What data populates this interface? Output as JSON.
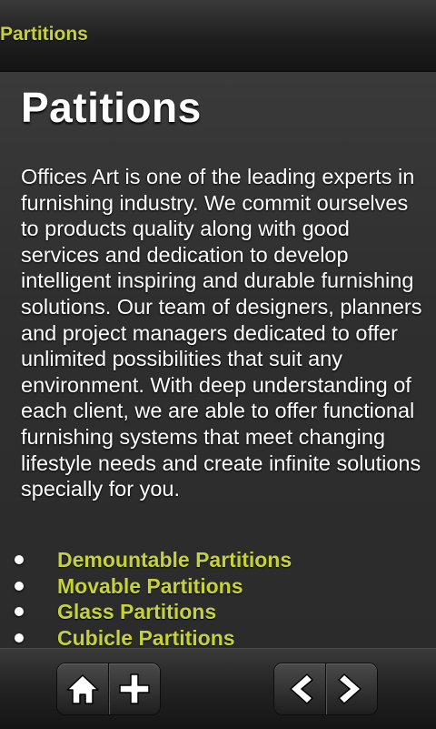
{
  "header": {
    "title": "Partitions"
  },
  "main": {
    "heading": "Patitions",
    "description": "Offices Art is one of the leading experts in furnishing industry. We commit ourselves to products quality along with good services and dedication to develop intelligent inspiring and durable furnishing solutions. Our team of designers, planners and project managers dedicated to offer unlimited possibilities that suit any environment. With deep understanding of each client, we are able to offer functional furnishing systems that meet changing lifestyle needs and create infinite solutions specially for you.",
    "links": [
      {
        "label": "Demountable Partitions"
      },
      {
        "label": "Movable Partitions"
      },
      {
        "label": "Glass Partitions"
      },
      {
        "label": "Cubicle Partitions"
      }
    ]
  },
  "toolbar": {
    "buttons": [
      {
        "icon": "home-icon"
      },
      {
        "icon": "plus-icon"
      },
      {
        "icon": "chevron-left-icon"
      },
      {
        "icon": "chevron-right-icon"
      }
    ]
  },
  "colors": {
    "accent": "#c6d23a",
    "text": "#ffffff",
    "background": "#2d2d2d"
  }
}
